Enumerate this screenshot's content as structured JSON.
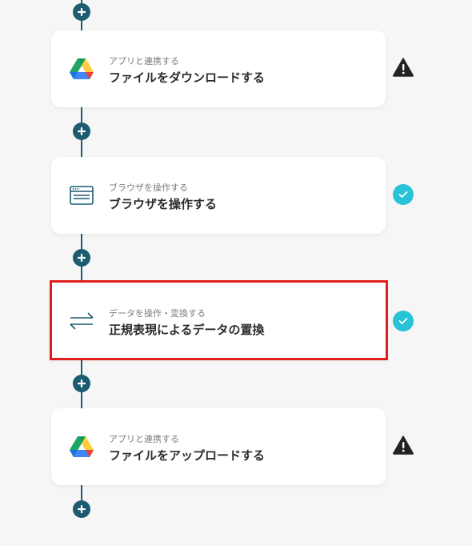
{
  "steps": [
    {
      "subtitle": "アプリと連携する",
      "title": "ファイルをダウンロードする",
      "icon": "google-drive-icon",
      "status": "warning"
    },
    {
      "subtitle": "ブラウザを操作する",
      "title": "ブラウザを操作する",
      "icon": "browser-icon",
      "status": "complete"
    },
    {
      "subtitle": "データを操作・変換する",
      "title": "正規表現によるデータの置換",
      "icon": "swap-arrows-icon",
      "status": "complete"
    },
    {
      "subtitle": "アプリと連携する",
      "title": "ファイルをアップロードする",
      "icon": "google-drive-icon",
      "status": "warning"
    }
  ],
  "colors": {
    "connector": "#1c5b70",
    "check": "#27c4d8",
    "warning": "#222222",
    "highlight": "#e01e1e"
  }
}
